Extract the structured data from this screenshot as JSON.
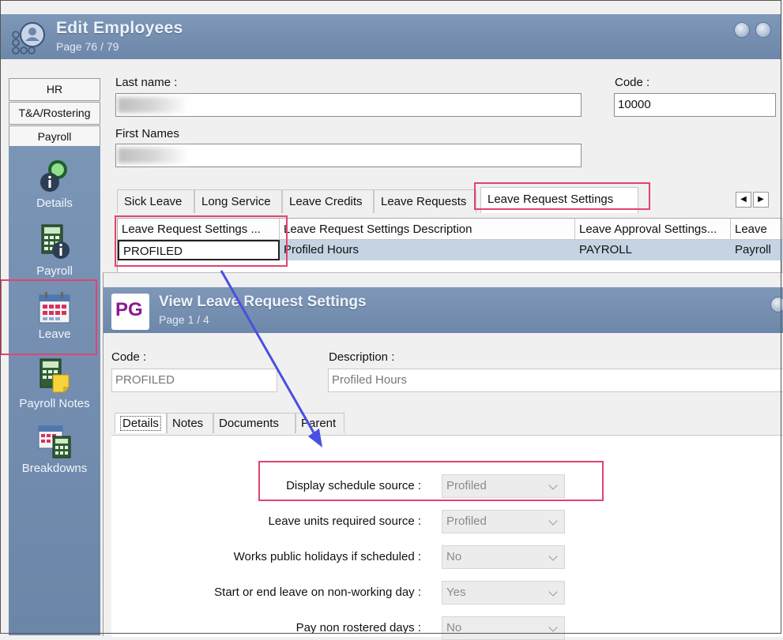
{
  "window": {
    "title": "Edit Employees",
    "page": "Page 76 / 79"
  },
  "nav": {
    "tabs": [
      "HR",
      "T&A/Rostering",
      "Payroll"
    ],
    "items": [
      {
        "label": "Details",
        "icon": "details-icon"
      },
      {
        "label": "Payroll",
        "icon": "payroll-calculator-icon"
      },
      {
        "label": "Leave",
        "icon": "calendar-icon"
      },
      {
        "label": "Payroll Notes",
        "icon": "notes-icon"
      },
      {
        "label": "Breakdowns",
        "icon": "breakdowns-icon"
      }
    ]
  },
  "form": {
    "last_name_label": "Last name :",
    "code_label": "Code :",
    "code_value": "10000",
    "first_names_label": "First Names"
  },
  "tabs": [
    "Sick Leave",
    "Long Service",
    "Leave Credits",
    "Leave Requests",
    "Leave Request Settings"
  ],
  "grid": {
    "headers": [
      "Leave Request Settings ...",
      "Leave Request Settings Description",
      "Leave Approval Settings...",
      "Leave"
    ],
    "row": [
      "PROFILED",
      "Profiled Hours",
      "PAYROLL",
      "Payroll"
    ]
  },
  "dialog": {
    "logo_text": "PG",
    "title": "View Leave Request Settings",
    "page": "Page 1 / 4",
    "code_label": "Code :",
    "code_value": "PROFILED",
    "description_label": "Description :",
    "description_value": "Profiled Hours",
    "tabs": [
      "Details",
      "Notes",
      "Documents",
      "Parent"
    ],
    "settings": [
      {
        "label": "Display schedule source :",
        "value": "Profiled"
      },
      {
        "label": "Leave units required source :",
        "value": "Profiled"
      },
      {
        "label": "Works public holidays if scheduled :",
        "value": "No"
      },
      {
        "label": "Start or end leave on non-working day :",
        "value": "Yes"
      },
      {
        "label": "Pay non rostered days :",
        "value": "No"
      }
    ]
  },
  "colors": {
    "titlebar": "#7590b3",
    "highlight": "#e0456d",
    "arrow": "#4a4fe0",
    "selected_row": "#c5d3e3"
  }
}
